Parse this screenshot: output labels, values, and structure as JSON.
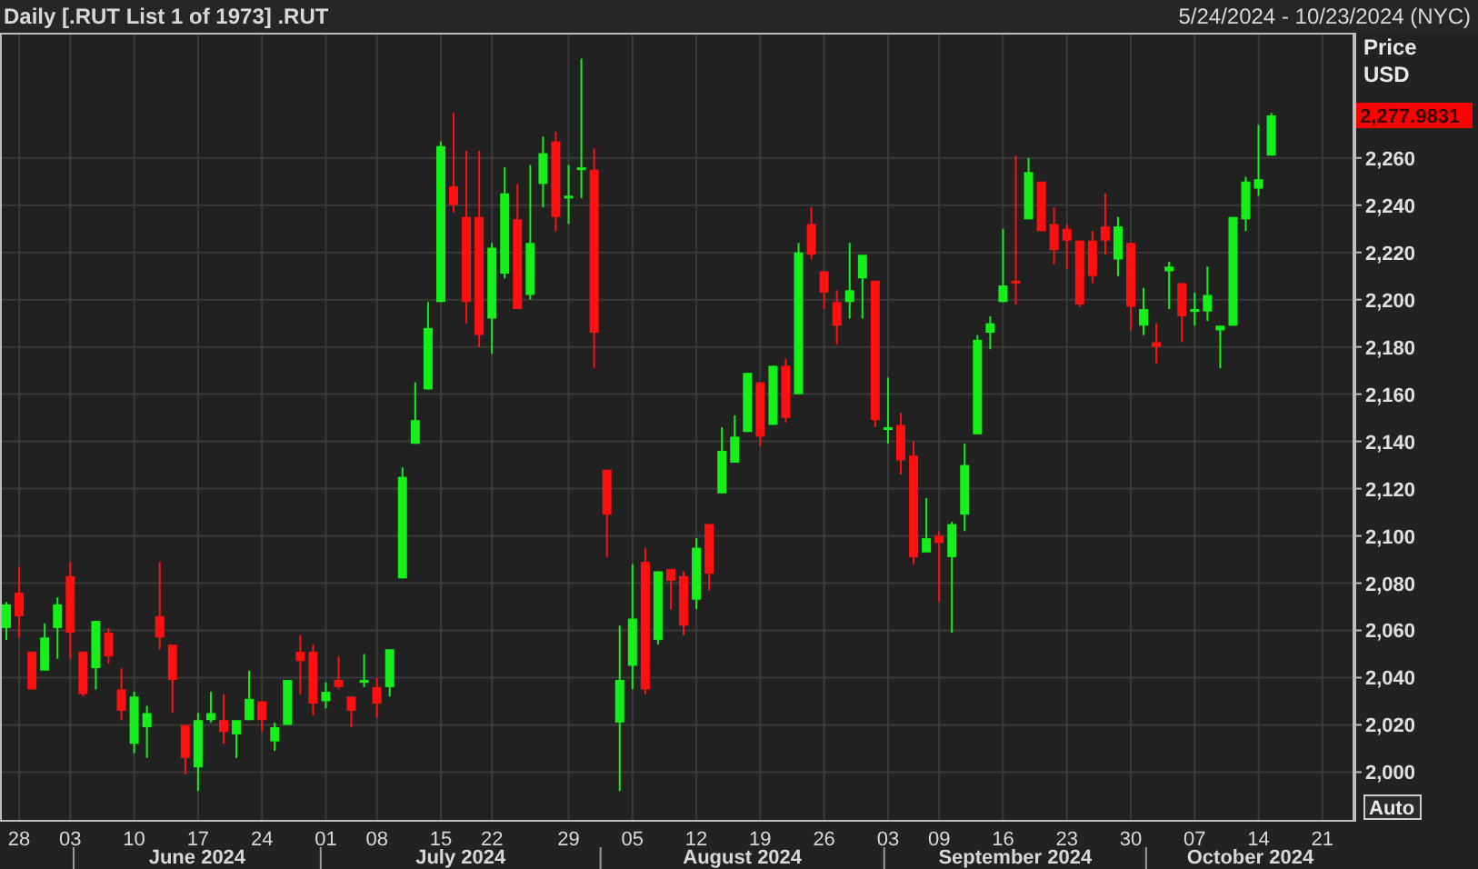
{
  "header": {
    "title": "Daily [.RUT List 1 of 1973] .RUT",
    "date_range": "5/24/2024 - 10/23/2024 (NYC)"
  },
  "price_axis": {
    "title": "Price",
    "unit": "USD",
    "last_price": "2,277.9831",
    "scale_button": "Auto"
  },
  "chart": {
    "chart_data": {
      "type": "candlestick",
      "grid": true,
      "ylim": [
        1979,
        2313
      ],
      "categories": [
        null,
        "28",
        null,
        null,
        null,
        "03",
        null,
        null,
        null,
        null,
        "10",
        null,
        null,
        null,
        null,
        "17",
        null,
        null,
        null,
        null,
        "24",
        null,
        null,
        null,
        null,
        "01",
        null,
        null,
        null,
        "08",
        null,
        null,
        null,
        null,
        "15",
        null,
        null,
        null,
        "22",
        null,
        null,
        null,
        null,
        null,
        "29",
        null,
        null,
        null,
        null,
        "05",
        null,
        null,
        null,
        null,
        "12",
        null,
        null,
        null,
        null,
        "19",
        null,
        null,
        null,
        null,
        "26",
        null,
        null,
        null,
        null,
        "03",
        null,
        null,
        null,
        "09",
        null,
        null,
        null,
        null,
        "16",
        null,
        null,
        null,
        null,
        "23",
        null,
        null,
        null,
        null,
        "30",
        null,
        null,
        null,
        null,
        "07",
        null,
        null,
        null,
        null,
        "14",
        null,
        null,
        null,
        null,
        "21",
        null,
        null
      ],
      "ohlc": [
        [
          2061,
          2072,
          2056,
          2071
        ],
        [
          2076,
          2087,
          2057,
          2066
        ],
        [
          2051,
          2051,
          2035,
          2035
        ],
        [
          2043,
          2063,
          2043,
          2057
        ],
        [
          2061,
          2074,
          2048,
          2071
        ],
        [
          2083,
          2089,
          2048,
          2059
        ],
        [
          2051,
          2051,
          2032,
          2033
        ],
        [
          2044,
          2064,
          2035,
          2064
        ],
        [
          2059,
          2061,
          2046,
          2049
        ],
        [
          2035,
          2044,
          2022,
          2026
        ],
        [
          2012,
          2034,
          2008,
          2032
        ],
        [
          2019,
          2028,
          2006,
          2025
        ],
        [
          2066,
          2089,
          2052,
          2057
        ],
        [
          2054,
          2054,
          2025,
          2039
        ],
        [
          2020,
          2020,
          1999,
          2006
        ],
        [
          2002,
          2025,
          1992,
          2022
        ],
        [
          2022,
          2034,
          2021,
          2025
        ],
        [
          2022,
          2033,
          2012,
          2017
        ],
        [
          2016,
          2022,
          2006,
          2022
        ],
        [
          2022,
          2043,
          2022,
          2031
        ],
        [
          2030,
          2030,
          2017,
          2022
        ],
        [
          2013,
          2021,
          2009,
          2019
        ],
        [
          2020,
          2039,
          2020,
          2039
        ],
        [
          2051,
          2058,
          2033,
          2047
        ],
        [
          2051,
          2054,
          2024,
          2029
        ],
        [
          2030,
          2038,
          2027,
          2034
        ],
        [
          2039,
          2049,
          2035,
          2036
        ],
        [
          2032,
          2032,
          2019,
          2026
        ],
        [
          2038,
          2050,
          2036,
          2039
        ],
        [
          2036,
          2040,
          2023,
          2029
        ],
        [
          2036,
          2052,
          2032,
          2052
        ],
        [
          2082,
          2129,
          2082,
          2125
        ],
        [
          2139,
          2165,
          2139,
          2149
        ],
        [
          2162,
          2199,
          2162,
          2188
        ],
        [
          2199,
          2267,
          2199,
          2265
        ],
        [
          2248,
          2279,
          2237,
          2240
        ],
        [
          2235,
          2263,
          2190,
          2199
        ],
        [
          2235,
          2263,
          2180,
          2185
        ],
        [
          2192,
          2224,
          2177,
          2222
        ],
        [
          2211,
          2256,
          2209,
          2245
        ],
        [
          2234,
          2249,
          2196,
          2196
        ],
        [
          2202,
          2257,
          2200,
          2224
        ],
        [
          2249,
          2269,
          2239,
          2262
        ],
        [
          2267,
          2271,
          2229,
          2235
        ],
        [
          2243,
          2257,
          2232,
          2244
        ],
        [
          2255,
          2302,
          2243,
          2256
        ],
        [
          2255,
          2264,
          2171,
          2186
        ],
        [
          2128,
          2128,
          2091,
          2109
        ],
        [
          2021,
          2062,
          1992,
          2039
        ],
        [
          2045,
          2088,
          2035,
          2065
        ],
        [
          2089,
          2095,
          2033,
          2035
        ],
        [
          2056,
          2085,
          2054,
          2085
        ],
        [
          2086,
          2086,
          2069,
          2081
        ],
        [
          2083,
          2085,
          2058,
          2062
        ],
        [
          2073,
          2099,
          2069,
          2095
        ],
        [
          2105,
          2105,
          2077,
          2084
        ],
        [
          2118,
          2146,
          2118,
          2136
        ],
        [
          2131,
          2151,
          2131,
          2142
        ],
        [
          2144,
          2169,
          2144,
          2169
        ],
        [
          2165,
          2165,
          2138,
          2142
        ],
        [
          2147,
          2172,
          2147,
          2172
        ],
        [
          2172,
          2175,
          2148,
          2150
        ],
        [
          2160,
          2224,
          2160,
          2220
        ],
        [
          2232,
          2239,
          2217,
          2219
        ],
        [
          2212,
          2212,
          2196,
          2203
        ],
        [
          2199,
          2204,
          2181,
          2189
        ],
        [
          2199,
          2224,
          2192,
          2204
        ],
        [
          2209,
          2219,
          2192,
          2219
        ],
        [
          2208,
          2208,
          2146,
          2149
        ],
        [
          2145,
          2167,
          2139,
          2146
        ],
        [
          2147,
          2152,
          2126,
          2132
        ],
        [
          2134,
          2140,
          2088,
          2091
        ],
        [
          2093,
          2116,
          2093,
          2099
        ],
        [
          2100,
          2102,
          2072,
          2097
        ],
        [
          2091,
          2106,
          2059,
          2105
        ],
        [
          2109,
          2139,
          2102,
          2130
        ],
        [
          2143,
          2185,
          2143,
          2183
        ],
        [
          2186,
          2193,
          2179,
          2190
        ],
        [
          2199,
          2230,
          2199,
          2206
        ],
        [
          2208,
          2261,
          2198,
          2207
        ],
        [
          2234,
          2260,
          2234,
          2254
        ],
        [
          2250,
          2250,
          2229,
          2229
        ],
        [
          2232,
          2239,
          2215,
          2221
        ],
        [
          2230,
          2232,
          2213,
          2225
        ],
        [
          2225,
          2225,
          2197,
          2198
        ],
        [
          2225,
          2229,
          2207,
          2210
        ],
        [
          2231,
          2245,
          2219,
          2225
        ],
        [
          2217,
          2235,
          2210,
          2231
        ],
        [
          2224,
          2224,
          2187,
          2197
        ],
        [
          2189,
          2205,
          2185,
          2196
        ],
        [
          2182,
          2190,
          2173,
          2180
        ],
        [
          2212,
          2216,
          2196,
          2214
        ],
        [
          2207,
          2207,
          2182,
          2193
        ],
        [
          2195,
          2203,
          2189,
          2196
        ],
        [
          2195,
          2214,
          2191,
          2202
        ],
        [
          2187,
          2189,
          2171,
          2189
        ],
        [
          2189,
          2235,
          2189,
          2235
        ],
        [
          2234,
          2252,
          2229,
          2250
        ],
        [
          2247,
          2274,
          2244,
          2251
        ],
        [
          2261,
          2279,
          2261,
          2278
        ],
        null,
        null,
        null,
        null,
        null,
        null
      ],
      "yticks": [
        {
          "value": 2260,
          "label": "2,260"
        },
        {
          "value": 2240,
          "label": "2,240"
        },
        {
          "value": 2220,
          "label": "2,220"
        },
        {
          "value": 2200,
          "label": "2,200"
        },
        {
          "value": 2180,
          "label": "2,180"
        },
        {
          "value": 2160,
          "label": "2,160"
        },
        {
          "value": 2140,
          "label": "2,140"
        },
        {
          "value": 2120,
          "label": "2,120"
        },
        {
          "value": 2100,
          "label": "2,100"
        },
        {
          "value": 2080,
          "label": "2,080"
        },
        {
          "value": 2060,
          "label": "2,060"
        },
        {
          "value": 2040,
          "label": "2,040"
        },
        {
          "value": 2020,
          "label": "2,020"
        },
        {
          "value": 2000,
          "label": "2,000"
        }
      ]
    },
    "month_labels": [
      "June 2024",
      "July 2024",
      "August 2024",
      "September 2024",
      "October 2024"
    ]
  }
}
